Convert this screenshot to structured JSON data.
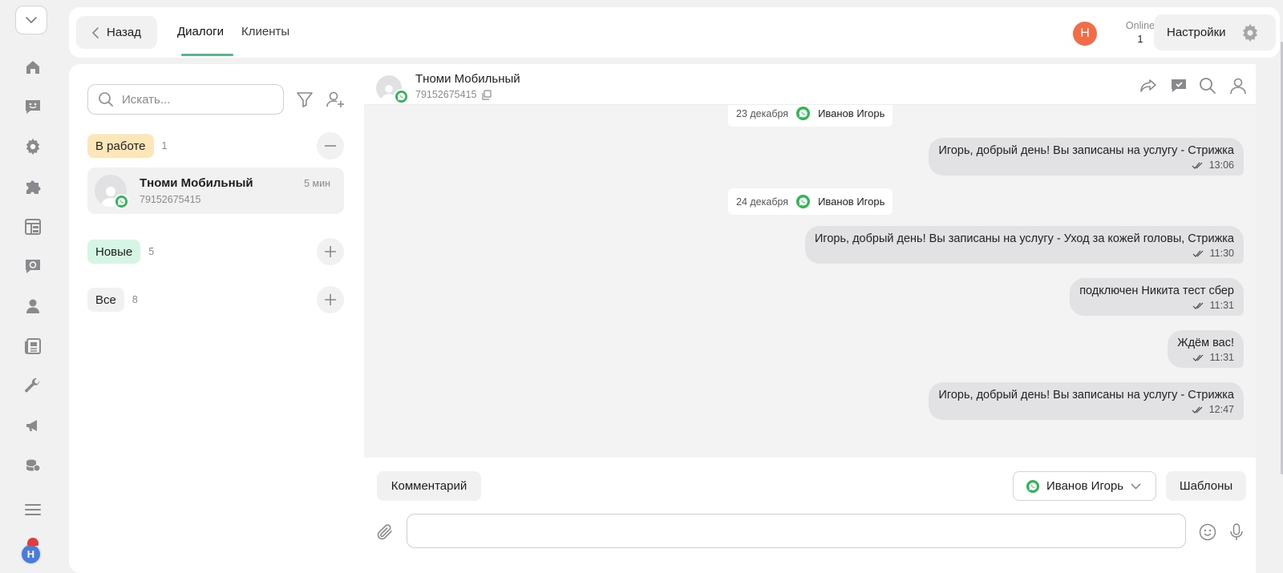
{
  "rail": {
    "items": [
      {
        "name": "home-icon"
      },
      {
        "name": "chat-smile-icon"
      },
      {
        "name": "gear-icon"
      },
      {
        "name": "puzzle-icon"
      },
      {
        "name": "layout-icon"
      },
      {
        "name": "support-chat-icon"
      },
      {
        "name": "person-icon"
      },
      {
        "name": "newspaper-icon"
      },
      {
        "name": "wrench-icon"
      },
      {
        "name": "megaphone-icon"
      },
      {
        "name": "coins-icon"
      },
      {
        "name": "menu-icon"
      }
    ],
    "avatar_letter": "Н"
  },
  "header": {
    "back_label": "Назад",
    "tabs": [
      {
        "label": "Диалоги",
        "active": true
      },
      {
        "label": "Клиенты",
        "active": false
      }
    ],
    "user_initial": "Н",
    "online_label": "Online",
    "online_count": "1",
    "settings_label": "Настройки"
  },
  "left": {
    "search_placeholder": "Искать...",
    "groups": [
      {
        "label": "В работе",
        "count": "1",
        "action": "collapse"
      },
      {
        "label": "Новые",
        "count": "5",
        "action": "expand"
      },
      {
        "label": "Все",
        "count": "8",
        "action": "expand"
      }
    ],
    "dialog": {
      "name": "Тноми Мобильный",
      "phone": "79152675415",
      "time": "5 мин"
    }
  },
  "chat": {
    "contact_name": "Тноми Мобильный",
    "contact_phone": "79152675415",
    "date_separators": [
      {
        "date": "23 декабря",
        "sender": "Иванов Игорь"
      },
      {
        "date": "24 декабря",
        "sender": "Иванов Игорь"
      }
    ],
    "messages": [
      {
        "text": "Игорь, добрый день! Вы записаны на услугу - Стрижка",
        "time": "13:06"
      },
      {
        "text": "Игорь, добрый день! Вы записаны на услугу - Уход за кожей головы, Стрижка",
        "time": "11:30"
      },
      {
        "text": "подключен Никита тест сбер",
        "time": "11:31"
      },
      {
        "text": "Ждём вас!",
        "time": "11:31"
      },
      {
        "text": "Игорь, добрый день! Вы записаны на услугу - Стрижка",
        "time": "12:47"
      }
    ],
    "comment_label": "Комментарий",
    "sender_label": "Иванов Игорь",
    "templates_label": "Шаблоны",
    "input_value": ""
  },
  "colors": {
    "accent_green": "#43c18a",
    "whatsapp": "#2fb756",
    "avatar_orange": "#f26d46",
    "badge_work": "#fde6b8",
    "badge_new": "#d5f5e5"
  }
}
